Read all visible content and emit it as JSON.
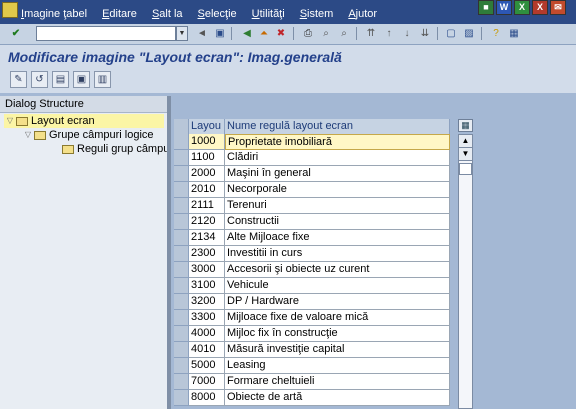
{
  "menubar": {
    "items": [
      {
        "pre": "I",
        "rest": "magine ţabel"
      },
      {
        "pre": "E",
        "rest": "ditare"
      },
      {
        "pre": "S",
        "rest": "alt la"
      },
      {
        "pre": "S",
        "rest": "elecţie"
      },
      {
        "pre": "U",
        "rest": "tilităţi"
      },
      {
        "pre": "S",
        "rest": "istem"
      },
      {
        "pre": "A",
        "rest": "jutor"
      }
    ],
    "window_icons": [
      {
        "label": "■",
        "color": "#2f7c3a"
      },
      {
        "label": "W",
        "color": "#2d57b4"
      },
      {
        "label": "X",
        "color": "#2f8f3e"
      },
      {
        "label": "X",
        "color": "#b23a2b"
      },
      {
        "label": "✉",
        "color": "#c24b2c"
      }
    ]
  },
  "toolbar": {
    "command_value": "",
    "dropdown_glyph": "▼"
  },
  "title": "Modificare imagine \"Layout ecran\": Imag.generală",
  "app_toolbar": {
    "buttons": [
      "✎",
      "↺",
      "▤",
      "▣",
      "▥"
    ]
  },
  "dialog_structure": {
    "header": "Dialog Structure",
    "nodes": [
      {
        "label": "Layout ecran",
        "level": 0
      },
      {
        "label": "Grupe câmpuri logice",
        "level": 1
      },
      {
        "label": "Reguli grup câmpuri",
        "level": 2
      }
    ]
  },
  "table": {
    "columns": [
      "Layou",
      "Nume regulă layout ecran"
    ],
    "rows": [
      {
        "code": "1000",
        "name": "Proprietate imobiliară"
      },
      {
        "code": "1100",
        "name": "Clădiri"
      },
      {
        "code": "2000",
        "name": "Maşini în general"
      },
      {
        "code": "2010",
        "name": "Necorporale"
      },
      {
        "code": "2111",
        "name": "Terenuri"
      },
      {
        "code": "2120",
        "name": "Constructii"
      },
      {
        "code": "2134",
        "name": "Alte Mijloace fixe"
      },
      {
        "code": "2300",
        "name": "Investitii in curs"
      },
      {
        "code": "3000",
        "name": "Accesorii şi obiecte uz curent"
      },
      {
        "code": "3100",
        "name": "Vehicule"
      },
      {
        "code": "3200",
        "name": "DP / Hardware"
      },
      {
        "code": "3300",
        "name": "Mijloace fixe de valoare mică"
      },
      {
        "code": "4000",
        "name": "Mijloc  fix în construcţie"
      },
      {
        "code": "4010",
        "name": "Măsură investiţie capital"
      },
      {
        "code": "5000",
        "name": "Leasing"
      },
      {
        "code": "7000",
        "name": "Formare cheltuieli"
      },
      {
        "code": "8000",
        "name": "Obiecte de artă"
      }
    ]
  },
  "colors": {
    "menubar": "#2c4a86",
    "title": "#24418b",
    "background": "#a4b8d4",
    "selected_row": "#fff7c6"
  }
}
